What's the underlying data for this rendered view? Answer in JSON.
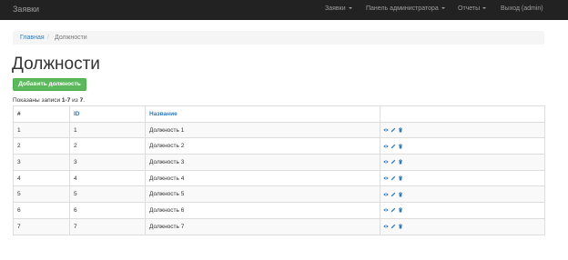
{
  "navbar": {
    "brand": "Заявки",
    "items": [
      {
        "label": "Заявки",
        "dropdown": true
      },
      {
        "label": "Панель администратора",
        "dropdown": true
      },
      {
        "label": "Отчеты",
        "dropdown": true
      },
      {
        "label": "Выход (admin)",
        "dropdown": false
      }
    ]
  },
  "breadcrumb": {
    "home": "Главная",
    "separator": "/",
    "active": "Должности"
  },
  "page": {
    "title": "Должности",
    "add_button": "Добавить должность"
  },
  "summary": {
    "prefix": "Показаны записи ",
    "range": "1-7",
    "middle": " из ",
    "total": "7",
    "suffix": "."
  },
  "table": {
    "columns": [
      "#",
      "ID",
      "Название",
      ""
    ],
    "rows": [
      {
        "num": "1",
        "id": "1",
        "name": "Должность 1"
      },
      {
        "num": "2",
        "id": "2",
        "name": "Должность 2"
      },
      {
        "num": "3",
        "id": "3",
        "name": "Должность 3"
      },
      {
        "num": "4",
        "id": "4",
        "name": "Должность 4"
      },
      {
        "num": "5",
        "id": "5",
        "name": "Должность 5"
      },
      {
        "num": "6",
        "id": "6",
        "name": "Должность 6"
      },
      {
        "num": "7",
        "id": "7",
        "name": "Должность 7"
      }
    ],
    "row_actions": [
      "eye-icon",
      "pencil-icon",
      "trash-icon"
    ]
  },
  "colors": {
    "navbar": "#222222",
    "link": "#337ab7",
    "success": "#5cb85c",
    "action_icon": "#337ab7"
  }
}
